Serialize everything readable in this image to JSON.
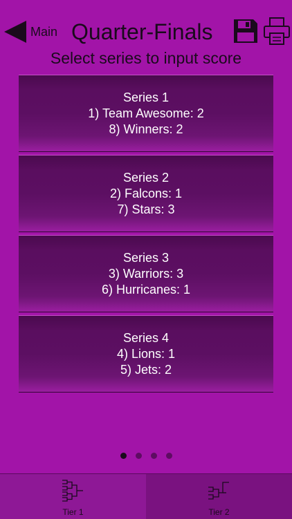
{
  "header": {
    "back_label": "Main",
    "title": "Quarter-Finals",
    "subtitle": "Select series to input score"
  },
  "series": [
    {
      "title": "Series 1",
      "team_a": "1) Team Awesome: 2",
      "team_b": "8) Winners: 2"
    },
    {
      "title": "Series 2",
      "team_a": "2) Falcons: 1",
      "team_b": "7) Stars: 3"
    },
    {
      "title": "Series 3",
      "team_a": "3) Warriors: 3",
      "team_b": "6) Hurricanes: 1"
    },
    {
      "title": "Series 4",
      "team_a": "4) Lions: 1",
      "team_b": "5) Jets: 2"
    }
  ],
  "pagination": {
    "total": 4,
    "active_index": 0
  },
  "tabs": [
    {
      "label": "Tier 1",
      "icon": "bracket-tier1-icon",
      "selected": true
    },
    {
      "label": "Tier 2",
      "icon": "bracket-tier2-icon",
      "selected": false
    }
  ],
  "colors": {
    "background": "#a214a8",
    "card": "#5c0f62",
    "tab_bar": "#7a1280",
    "text_dark": "#1a0a1c",
    "text_light": "#ffffff"
  },
  "icons": {
    "back": "back-arrow-icon",
    "save": "save-disk-icon",
    "print": "printer-icon"
  }
}
